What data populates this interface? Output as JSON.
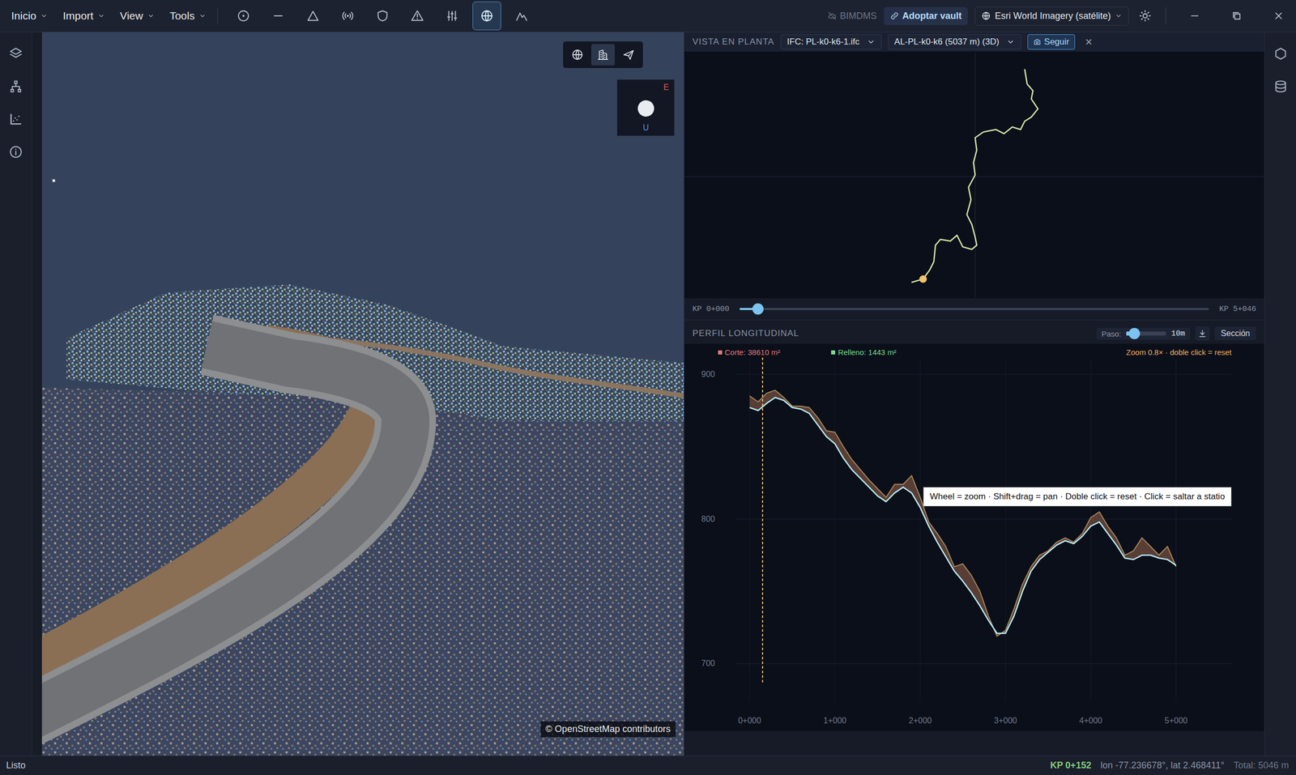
{
  "menu": [
    {
      "label": "Inicio"
    },
    {
      "label": "Import"
    },
    {
      "label": "View"
    },
    {
      "label": "Tools"
    }
  ],
  "toolbar": [
    {
      "kind": "point",
      "selected": false
    },
    {
      "kind": "line",
      "selected": false
    },
    {
      "kind": "triangle",
      "selected": false
    },
    {
      "kind": "broadcast",
      "selected": false
    },
    {
      "kind": "shield",
      "selected": false
    },
    {
      "kind": "warning",
      "selected": false
    },
    {
      "kind": "sliders",
      "selected": false
    },
    {
      "kind": "globe",
      "selected": true
    },
    {
      "kind": "mountain",
      "selected": false
    }
  ],
  "top_right": {
    "bimdms": {
      "label": "BIMDMS",
      "disabled": true
    },
    "vault": {
      "label": "Adoptar vault"
    },
    "basemap": {
      "label": "Esri World Imagery (satélite)"
    }
  },
  "window_controls": [
    {
      "kind": "minimize"
    },
    {
      "kind": "maximize"
    },
    {
      "kind": "close"
    }
  ],
  "left_sidebar": [
    {
      "kind": "layers"
    },
    {
      "kind": "tree"
    },
    {
      "kind": "chart"
    },
    {
      "kind": "info"
    }
  ],
  "viewport": {
    "modes": [
      {
        "kind": "globe",
        "selected": false
      },
      {
        "kind": "building",
        "selected": true
      },
      {
        "kind": "plane",
        "selected": false
      }
    ],
    "gizmo": {
      "east": "E",
      "up": "U"
    },
    "attribution": "© OpenStreetMap contributors"
  },
  "plan": {
    "title": "VISTA EN PLANTA",
    "model": "IFC: PL-k0-k6-1.ifc",
    "alignment": "AL-PL-k0-k6 (5037 m) (3D)",
    "follow": {
      "label": "Seguir",
      "selected": true
    },
    "close": "×"
  },
  "kp_slider": {
    "start": "KP 0+000",
    "end": "KP 5+046",
    "level": 0.03
  },
  "profile": {
    "title": "PERFIL LONGITUDINAL",
    "step": {
      "label": "Paso:",
      "level": 0.1,
      "reading": "10m"
    },
    "section": "Sección",
    "legend": [
      {
        "label": "Corte: 38610 m²",
        "color": "#e07a7a"
      },
      {
        "label": "Relleno: 1443 m²",
        "color": "#7adc8a"
      }
    ],
    "zoom": "Zoom 0.8× · doble click = reset",
    "y_ticks": [
      "900",
      "800",
      "700"
    ],
    "x_ticks": [
      "0+000",
      "1+000",
      "2+000",
      "3+000",
      "4+000",
      "5+000"
    ],
    "cursor_station": 152,
    "tooltip": "Wheel = zoom · Shift+drag = pan · Doble click = reset · Click = saltar a statio",
    "series": [
      {
        "kind": "terrain",
        "color": "#a9885c",
        "values": [
          885,
          881,
          887,
          889,
          884,
          878,
          878,
          877,
          870,
          861,
          860,
          850,
          841,
          834,
          827,
          821,
          815,
          824,
          824,
          830,
          815,
          798,
          790,
          781,
          767,
          769,
          761,
          750,
          733,
          719,
          723,
          738,
          755,
          767,
          775,
          778,
          784,
          787,
          784,
          790,
          801,
          805,
          795,
          787,
          775,
          778,
          787,
          781,
          775,
          781,
          767
        ]
      },
      {
        "kind": "grade",
        "color": "#b9ecf7",
        "values": [
          877,
          875,
          880,
          884,
          882,
          877,
          876,
          873,
          865,
          857,
          852,
          842,
          834,
          828,
          822,
          816,
          812,
          818,
          822,
          818,
          808,
          795,
          784,
          774,
          764,
          757,
          749,
          740,
          730,
          721,
          721,
          733,
          750,
          764,
          772,
          777,
          782,
          785,
          783,
          788,
          795,
          798,
          790,
          782,
          773,
          772,
          775,
          775,
          773,
          772,
          768
        ]
      }
    ]
  },
  "right_sidebar": [
    {
      "kind": "cube"
    },
    {
      "kind": "database"
    }
  ],
  "status_bar": {
    "left": "Listo",
    "kp": "KP 0+152",
    "coords": "lon -77.236678°, lat 2.468411°",
    "total": "Total: 5046 m"
  }
}
